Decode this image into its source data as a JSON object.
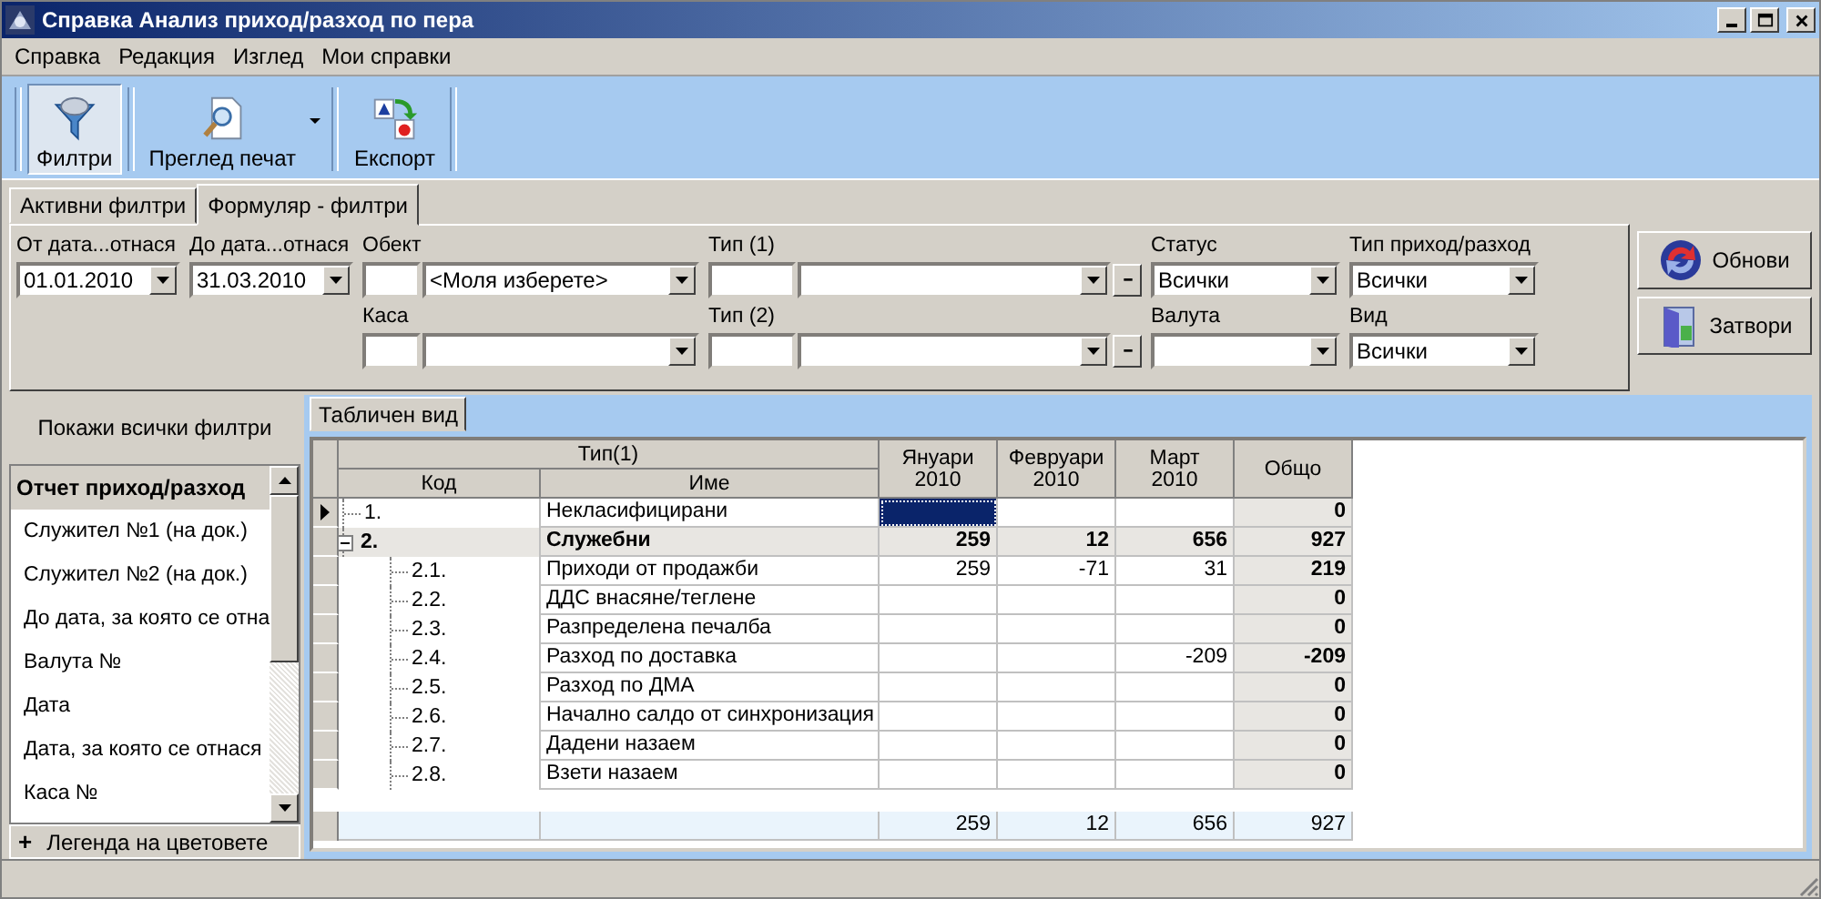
{
  "window": {
    "title": "Справка Анализ приход/разход по пера"
  },
  "menu": [
    "Справка",
    "Редакция",
    "Изглед",
    "Мои справки"
  ],
  "toolbar": [
    {
      "label": "Филтри",
      "kind": "filter",
      "selected": true
    },
    {
      "label": "Преглед печат",
      "kind": "preview",
      "selected": false,
      "dropdown": true
    },
    {
      "label": "Експорт",
      "kind": "export",
      "selected": false
    }
  ],
  "tabs": [
    {
      "label": "Активни филтри",
      "selected": false
    },
    {
      "label": "Формуляр - филтри",
      "selected": true
    }
  ],
  "filter_columns": [
    [
      {
        "label": "От дата...отнася",
        "kind": "date",
        "value": "01.01.2010"
      }
    ],
    [
      {
        "label": "До дата...отнася",
        "kind": "date",
        "value": "31.03.2010"
      }
    ],
    [
      {
        "label": "Обект",
        "kind": "code-combo",
        "value": "<Моля изберете>"
      },
      {
        "label": "Каса",
        "kind": "code-combo"
      }
    ],
    [
      {
        "label": "Тип (1)",
        "kind": "code-combo-clear"
      },
      {
        "label": "Тип (2)",
        "kind": "code-combo-clear"
      }
    ],
    [
      {
        "label": "Статус",
        "kind": "combo",
        "value": "Всички"
      },
      {
        "label": "Валута",
        "kind": "combo"
      }
    ],
    [
      {
        "label": "Тип приход/разход",
        "kind": "combo",
        "value": "Всички"
      },
      {
        "label": "Вид",
        "kind": "combo",
        "value": "Всички"
      }
    ]
  ],
  "action_buttons": [
    {
      "label": "Обнови",
      "kind": "refresh"
    },
    {
      "label": "Затвори",
      "kind": "close"
    }
  ],
  "sidebar": {
    "show_all": "Покажи всички филтри",
    "items": [
      {
        "label": "Отчет приход/разход",
        "kind": "header"
      },
      {
        "label": "Служител №1 (на док.)",
        "kind": "item"
      },
      {
        "label": "Служител №2 (на док.)",
        "kind": "item"
      },
      {
        "label": "До дата, за която се отна",
        "kind": "item"
      },
      {
        "label": "Валута №",
        "kind": "item"
      },
      {
        "label": "Дата",
        "kind": "item"
      },
      {
        "label": "Дата, за която се отнася",
        "kind": "item"
      },
      {
        "label": "Каса №",
        "kind": "item"
      }
    ],
    "legend": {
      "expander": "+",
      "label": "Легенда на цветовете"
    }
  },
  "grid": {
    "tab": "Табличен вид",
    "group_header": "Тип(1)",
    "columns": {
      "code": "Код",
      "name": "Име",
      "months": [
        "Януари 2010",
        "Февруари 2010",
        "Март 2010"
      ],
      "total": "Общо"
    },
    "rows": [
      {
        "code": "1.",
        "name": "Некласифицирани",
        "total": "0",
        "selected": true
      },
      {
        "code": "2.",
        "name": "Служебни",
        "month_1": "259",
        "month_2": "12",
        "month_3": "656",
        "total": "927",
        "selected": false,
        "expanded": true,
        "children": [
          {
            "code": "2.1.",
            "name": "Приходи от продажби",
            "month_1": "259",
            "month_2": "-71",
            "month_3": "31",
            "total": "219",
            "selected": false
          },
          {
            "code": "2.2.",
            "name": "ДДС внасяне/теглене",
            "total": "0",
            "selected": false
          },
          {
            "code": "2.3.",
            "name": "Разпределена печалба",
            "total": "0",
            "selected": false
          },
          {
            "code": "2.4.",
            "name": "Разход по доставка",
            "month_3": "-209",
            "total": "-209",
            "selected": false
          },
          {
            "code": "2.5.",
            "name": "Разход по ДМА",
            "total": "0",
            "selected": false
          },
          {
            "code": "2.6.",
            "name": "Начално салдо от синхронизация",
            "total": "0",
            "selected": false
          },
          {
            "code": "2.7.",
            "name": "Дадени назаем",
            "total": "0",
            "selected": false
          },
          {
            "code": "2.8.",
            "name": "Взети назаем",
            "total": "0",
            "selected": false
          }
        ]
      }
    ],
    "footer": {
      "month_1": "259",
      "month_2": "12",
      "month_3": "656",
      "total": "927"
    }
  }
}
